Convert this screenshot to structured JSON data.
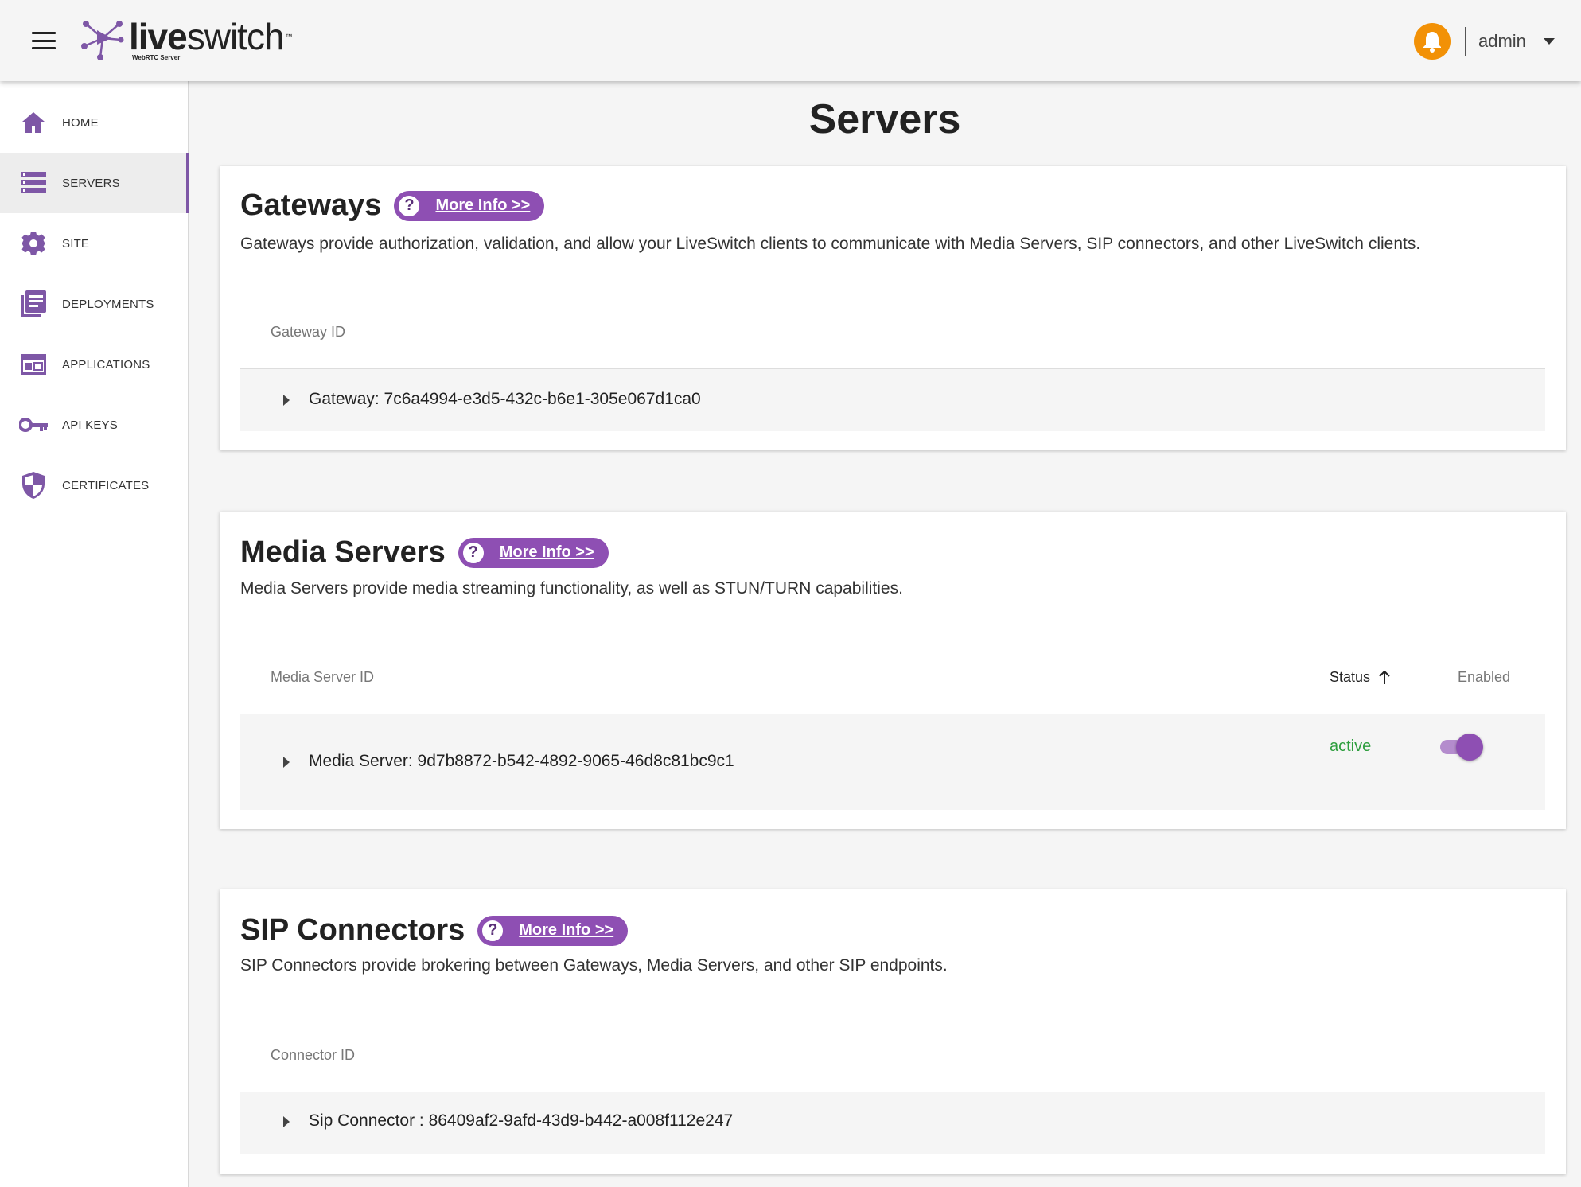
{
  "header": {
    "logo_live": "live",
    "logo_switch": "switch",
    "logo_subtitle": "WebRTC Server",
    "user_name": "admin"
  },
  "sidebar": {
    "items": [
      {
        "label": "HOME",
        "icon": "home-icon"
      },
      {
        "label": "SERVERS",
        "icon": "servers-icon",
        "active": true
      },
      {
        "label": "SITE",
        "icon": "gear-icon"
      },
      {
        "label": "DEPLOYMENTS",
        "icon": "deployments-icon"
      },
      {
        "label": "APPLICATIONS",
        "icon": "applications-icon"
      },
      {
        "label": "API KEYS",
        "icon": "key-icon"
      },
      {
        "label": "CERTIFICATES",
        "icon": "shield-icon"
      }
    ]
  },
  "main": {
    "title": "Servers",
    "gateways": {
      "title": "Gateways",
      "more_info": "More Info >>",
      "description": "Gateways provide authorization, validation, and allow your LiveSwitch clients to communicate with Media Servers, SIP connectors, and other LiveSwitch clients.",
      "col_id": "Gateway ID",
      "rows": [
        {
          "label": "Gateway: 7c6a4994-e3d5-432c-b6e1-305e067d1ca0"
        }
      ]
    },
    "media_servers": {
      "title": "Media Servers",
      "more_info": "More Info >>",
      "description": "Media Servers provide media streaming functionality, as well as STUN/TURN capabilities.",
      "col_id": "Media Server ID",
      "col_status": "Status",
      "col_enabled": "Enabled",
      "rows": [
        {
          "label": "Media Server: 9d7b8872-b542-4892-9065-46d8c81bc9c1",
          "status": "active",
          "enabled": true
        }
      ]
    },
    "sip_connectors": {
      "title": "SIP Connectors",
      "more_info": "More Info >>",
      "description": "SIP Connectors provide brokering between Gateways, Media Servers, and other SIP endpoints.",
      "col_id": "Connector ID",
      "rows": [
        {
          "label": "Sip Connector : 86409af2-9afd-43d9-b442-a008f112e247"
        }
      ]
    }
  },
  "colors": {
    "accent": "#8e4fb3",
    "bell": "#f29106",
    "status_active": "#2e9e3e",
    "nav_icon": "#7e57a6"
  }
}
